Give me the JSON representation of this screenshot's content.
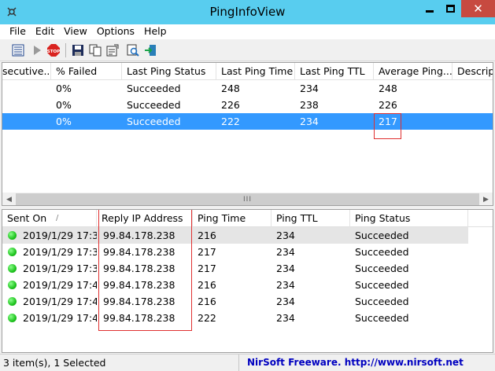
{
  "window": {
    "title": "PingInfoView"
  },
  "menu": [
    "File",
    "Edit",
    "View",
    "Options",
    "Help"
  ],
  "summary_table": {
    "columns": [
      "secutive...",
      "% Failed",
      "Last Ping Status",
      "Last Ping Time",
      "Last Ping TTL",
      "Average Ping...",
      "Descript"
    ],
    "rows": [
      [
        "",
        "0%",
        "Succeeded",
        "248",
        "234",
        "248",
        ""
      ],
      [
        "",
        "0%",
        "Succeeded",
        "226",
        "238",
        "226",
        ""
      ],
      [
        "",
        "0%",
        "Succeeded",
        "222",
        "234",
        "217",
        ""
      ]
    ],
    "selected_row": 2
  },
  "scrollbar": {
    "grip": "III"
  },
  "history_table": {
    "columns": [
      "Sent On",
      "Reply IP Address",
      "Ping Time",
      "Ping TTL",
      "Ping Status"
    ],
    "sort_indicator": "/",
    "rows": [
      [
        "2019/1/29 17:3...",
        "99.84.178.238",
        "216",
        "234",
        "Succeeded"
      ],
      [
        "2019/1/29 17:3...",
        "99.84.178.238",
        "217",
        "234",
        "Succeeded"
      ],
      [
        "2019/1/29 17:3...",
        "99.84.178.238",
        "217",
        "234",
        "Succeeded"
      ],
      [
        "2019/1/29 17:4...",
        "99.84.178.238",
        "216",
        "234",
        "Succeeded"
      ],
      [
        "2019/1/29 17:4...",
        "99.84.178.238",
        "216",
        "234",
        "Succeeded"
      ],
      [
        "2019/1/29 17:4...",
        "99.84.178.238",
        "222",
        "234",
        "Succeeded"
      ]
    ]
  },
  "status": {
    "items": "3 item(s), 1 Selected",
    "credit": "NirSoft Freeware.  http://www.nirsoft.net"
  },
  "colors": {
    "titlebar": "#58cdef",
    "selection": "#3399ff",
    "close": "#c74a40",
    "annotation": "#e03030",
    "link": "#0000c0"
  }
}
